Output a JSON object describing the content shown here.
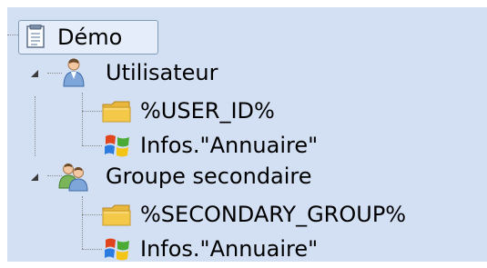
{
  "tree": {
    "root": {
      "label": "Démo",
      "icon": "document-icon"
    },
    "nodes": [
      {
        "label": "Utilisateur",
        "icon": "user-icon",
        "expanded": true,
        "children": [
          {
            "label": "%USER_ID%",
            "icon": "folder-icon"
          },
          {
            "label": "Infos.\"Annuaire\"",
            "icon": "windows-logo-icon"
          }
        ]
      },
      {
        "label": "Groupe secondaire",
        "icon": "group-icon",
        "expanded": true,
        "children": [
          {
            "label": "%SECONDARY_GROUP%",
            "icon": "folder-icon"
          },
          {
            "label": "Infos.\"Annuaire\"",
            "icon": "windows-logo-icon"
          }
        ]
      }
    ]
  },
  "colors": {
    "panel_bg": "#d3e0f3",
    "selection_bg": "#e4edf9",
    "selection_border": "#7f9db9",
    "tree_line": "#8a8a8a",
    "folder_yellow": "#f4c94a"
  }
}
